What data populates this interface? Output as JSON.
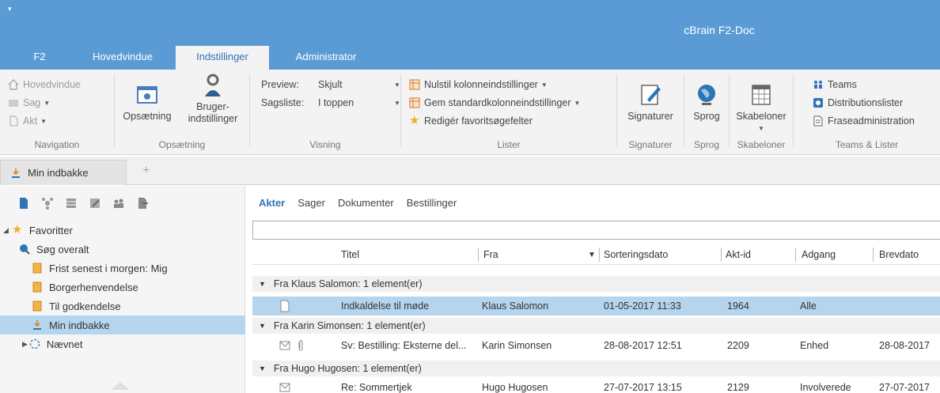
{
  "titlebar": {
    "quick_access": "▾",
    "app_title": "cBrain F2-Doc"
  },
  "tabs": [
    {
      "label": "F2"
    },
    {
      "label": "Hovedvindue"
    },
    {
      "label": "Indstillinger"
    },
    {
      "label": "Administrator"
    }
  ],
  "ribbon": {
    "navigation": {
      "label": "Navigation",
      "items": [
        "Hovedvindue",
        "Sag",
        "Akt"
      ]
    },
    "opsaetning": {
      "label": "Opsætning",
      "opsaetning_btn": "Opsætning",
      "bruger_btn_1": "Bruger-",
      "bruger_btn_2": "indstillinger"
    },
    "visning": {
      "label": "Visning",
      "preview_label": "Preview:",
      "preview_value": "Skjult",
      "sagsliste_label": "Sagsliste:",
      "sagsliste_value": "I toppen"
    },
    "lister": {
      "label": "Lister",
      "item1": "Nulstil kolonneindstillinger",
      "item2": "Gem standardkolonneindstillinger",
      "item3": "Redigér favoritsøgefelter"
    },
    "signaturer": {
      "label": "Signaturer",
      "btn": "Signaturer"
    },
    "sprog": {
      "label": "Sprog",
      "btn": "Sprog"
    },
    "skabeloner": {
      "label": "Skabeloner",
      "btn": "Skabeloner"
    },
    "teams": {
      "label": "Teams & Lister",
      "item1": "Teams",
      "item2": "Distributionslister",
      "item3": "Fraseadministration"
    }
  },
  "doctab": {
    "label": "Min indbakke",
    "plus": "+"
  },
  "tree": {
    "favorites": "Favoritter",
    "items": [
      "Søg overalt",
      "Frist senest i morgen: Mig",
      "Borgerhenvendelse",
      "Til godkendelse",
      "Min indbakke"
    ],
    "naevnet": "Nævnet"
  },
  "subtabs": [
    "Akter",
    "Sager",
    "Dokumenter",
    "Bestillinger"
  ],
  "columns": [
    "Titel",
    "Fra",
    "Sorteringsdato",
    "Akt-id",
    "Adgang",
    "Brevdato"
  ],
  "groups": [
    {
      "header": "Fra Klaus Salomon: 1 element(er)",
      "row": {
        "titel": "Indkaldelse til møde",
        "fra": "Klaus Salomon",
        "dato": "01-05-2017 11:33",
        "aktid": "1964",
        "adgang": "Alle",
        "brevdato": ""
      }
    },
    {
      "header": "Fra Karin Simonsen: 1 element(er)",
      "row": {
        "titel": "Sv: Bestilling: Eksterne del...",
        "fra": "Karin Simonsen",
        "dato": "28-08-2017 12:51",
        "aktid": "2209",
        "adgang": "Enhed",
        "brevdato": "28-08-2017"
      }
    },
    {
      "header": "Fra Hugo Hugosen: 1 element(er)",
      "row": {
        "titel": "Re: Sommertjek",
        "fra": "Hugo Hugosen",
        "dato": "27-07-2017 13:15",
        "aktid": "2129",
        "adgang": "Involverede",
        "brevdato": "27-07-2017"
      }
    }
  ],
  "colors": {
    "accent": "#5b9bd5",
    "selection": "#b5d4ee",
    "star": "#f0b030"
  }
}
